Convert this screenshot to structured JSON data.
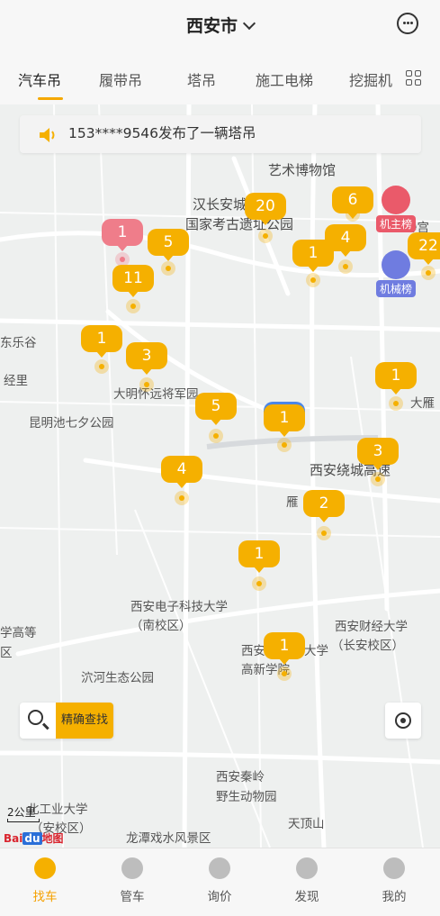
{
  "header": {
    "city": "西安市"
  },
  "tabs": [
    {
      "label": "汽车吊",
      "active": true
    },
    {
      "label": "履带吊",
      "active": false
    },
    {
      "label": "塔吊",
      "active": false
    },
    {
      "label": "施工电梯",
      "active": false
    },
    {
      "label": "挖掘机",
      "active": false
    }
  ],
  "notice": {
    "text": "153****9546发布了一辆塔吊"
  },
  "map_labels": [
    "艺术博物馆",
    "汉长安城",
    "国家考古遗址公园",
    "东乐谷",
    "经里",
    "大明怀远将军园",
    "昆明池七夕公园",
    "西安绕城高速",
    "雁",
    "大雁",
    "西安电子科技大学",
    "（南校区）",
    "西安财经大学",
    "（长安校区）",
    "西安",
    "高新学院",
    "大学",
    "泬河生态公园",
    "学高等",
    "区",
    "西安秦岭",
    "野生动物园",
    "天顶山",
    "北工业大学",
    "（安校区）",
    "龙潭戏水风景区",
    "瀞宫"
  ],
  "clusters": [
    "20",
    "6",
    "1",
    "5",
    "4",
    "22",
    "11",
    "1",
    "3",
    "1",
    "5",
    "1",
    "4",
    "3",
    "2",
    "1",
    "1"
  ],
  "badges": {
    "owner": "机主榜",
    "machine": "机械榜"
  },
  "search": {
    "button": "精确查找"
  },
  "scale": "2公里",
  "map_logo": "Baidu地图",
  "bottom_nav": [
    {
      "label": "找车",
      "icon": "navigate-icon",
      "active": true
    },
    {
      "label": "管车",
      "icon": "sliders-icon",
      "active": false
    },
    {
      "label": "询价",
      "icon": "yuan-icon",
      "active": false
    },
    {
      "label": "发现",
      "icon": "compass-icon",
      "active": false
    },
    {
      "label": "我的",
      "icon": "user-icon",
      "active": false
    }
  ],
  "colors": {
    "accent": "#f5b000",
    "pink": "#ef7d8a",
    "badge_owner": "#ea5a6a",
    "badge_machine": "#6f7ce0"
  }
}
